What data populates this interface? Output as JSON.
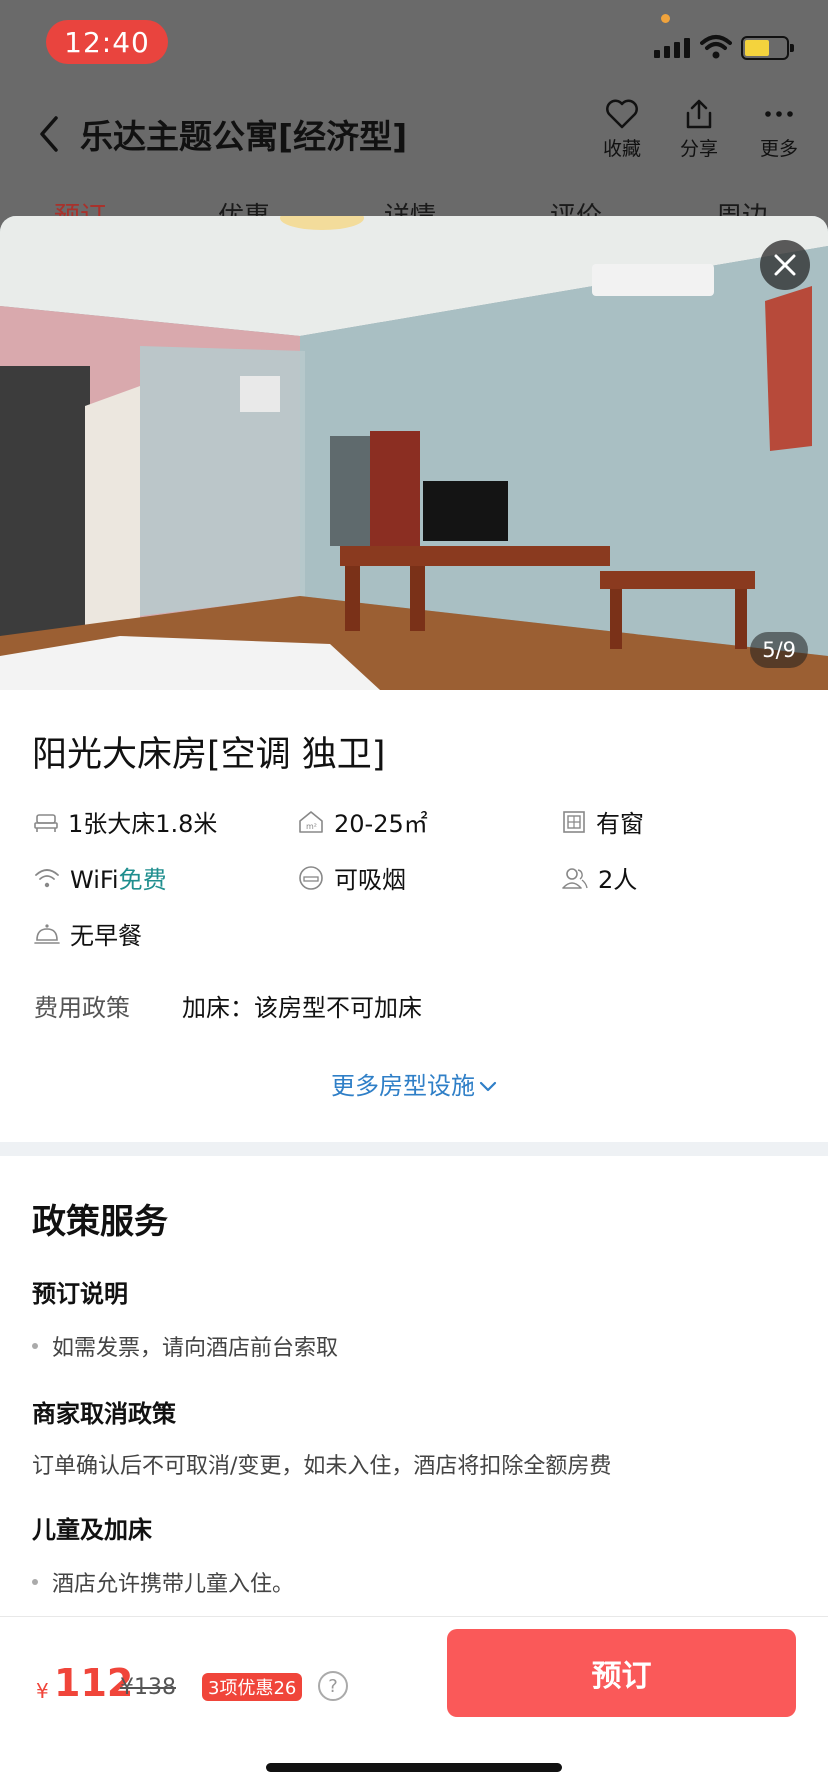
{
  "status_bar": {
    "time": "12:40"
  },
  "header": {
    "title": "乐达主题公寓[经济型]",
    "actions": [
      {
        "label": "收藏",
        "icon": "heart-icon"
      },
      {
        "label": "分享",
        "icon": "share-icon"
      },
      {
        "label": "更多",
        "icon": "more-icon"
      }
    ]
  },
  "tabs": [
    "预订",
    "优惠",
    "详情",
    "评价",
    "周边"
  ],
  "photo": {
    "counter": "5/9"
  },
  "room": {
    "title": "阳光大床房[空调 独卫]",
    "facilities": {
      "bed": "1张大床1.8米",
      "area": "20-25㎡",
      "window": "有窗",
      "wifi_label": "WiFi",
      "wifi_free": "免费",
      "smoking": "可吸烟",
      "people": "2人",
      "breakfast": "无早餐"
    },
    "fee_policy_key": "费用政策",
    "fee_policy_value": "加床：该房型不可加床",
    "more_link": "更多房型设施"
  },
  "policy": {
    "title": "政策服务",
    "booking_note_title": "预订说明",
    "booking_note": "如需发票，请向酒店前台索取",
    "cancel_title": "商家取消政策",
    "cancel_text": "订单确认后不可取消/变更，如未入住，酒店将扣除全额房费",
    "children_title": "儿童及加床",
    "children_text": "酒店允许携带儿童入住。"
  },
  "booking": {
    "currency": "¥",
    "price": "112",
    "original_price": "¥138",
    "discount": "3项优惠26",
    "help": "?",
    "button": "预订"
  },
  "colors": {
    "accent": "#fa5959",
    "price": "#f0453a",
    "link": "#2f7fc7",
    "free": "#1f8e8e"
  }
}
